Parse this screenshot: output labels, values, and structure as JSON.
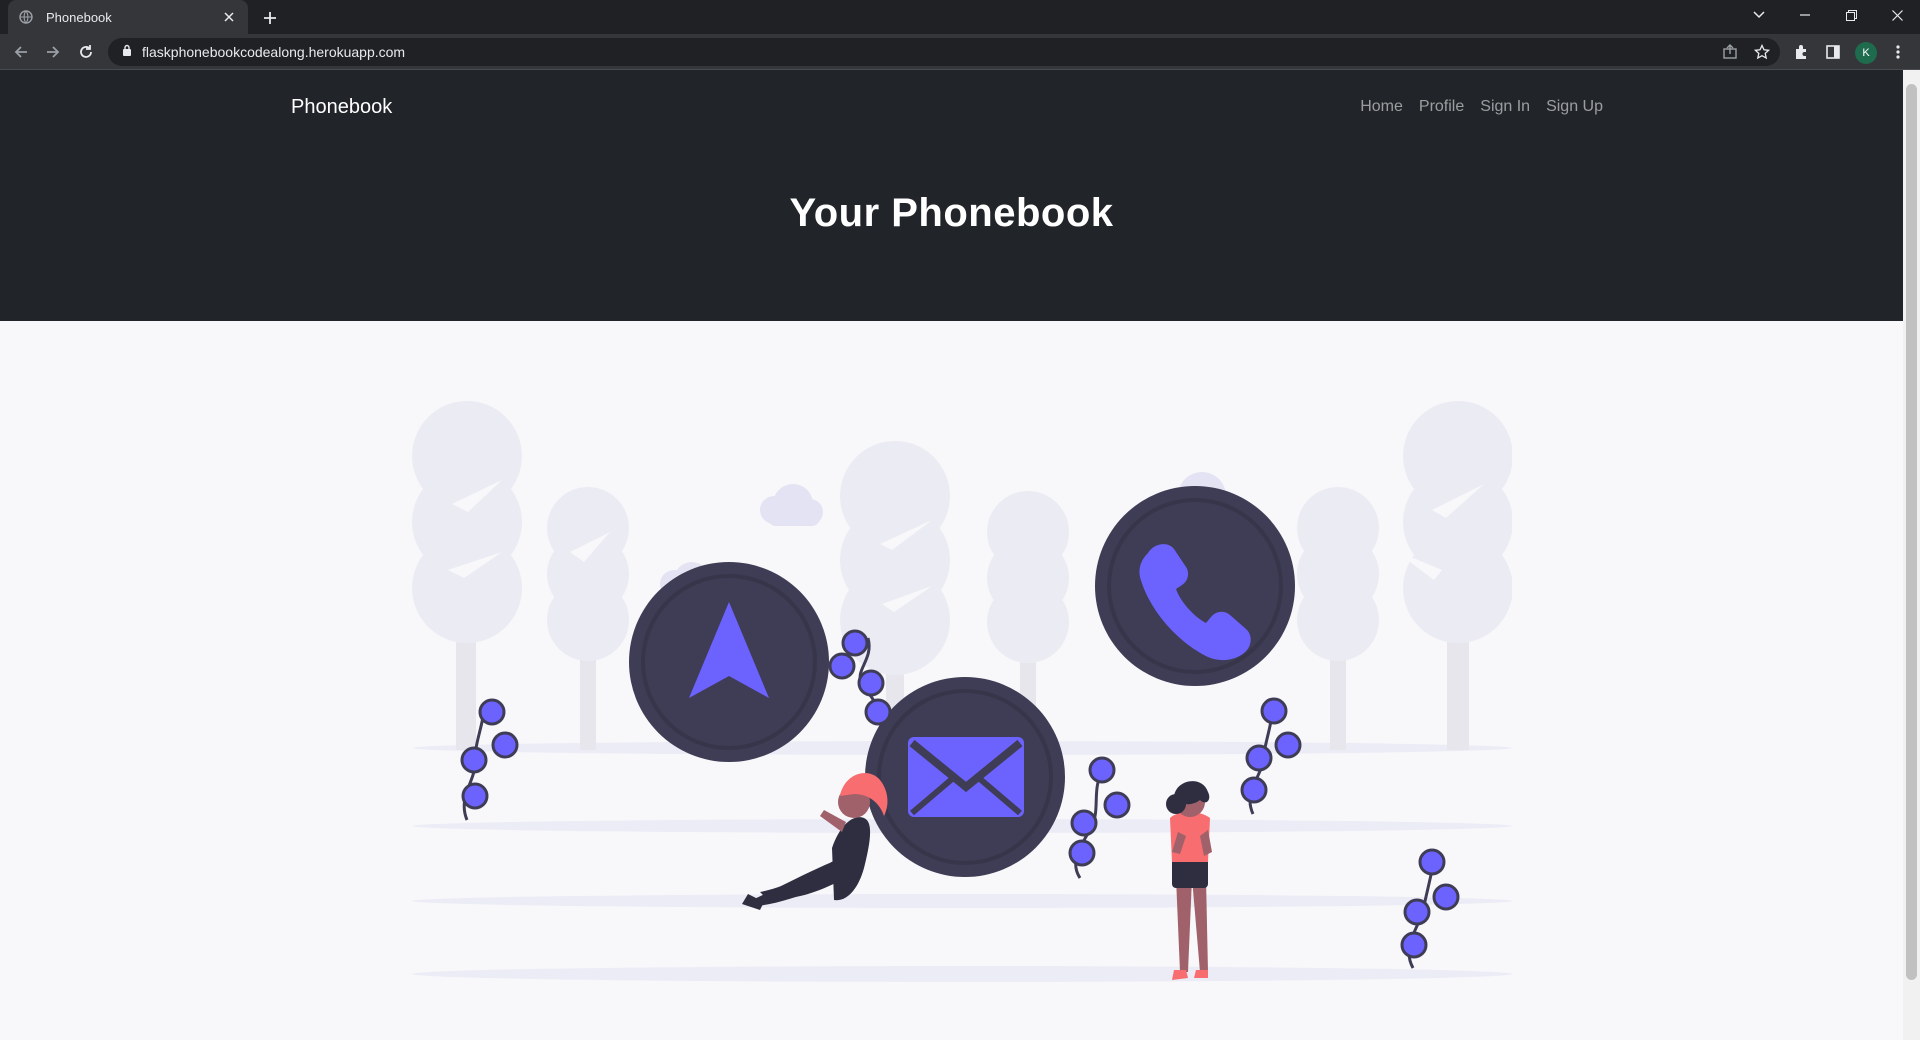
{
  "browser": {
    "tab_title": "Phonebook",
    "url": "flaskphonebookcodealong.herokuapp.com",
    "profile_initial": "K"
  },
  "navbar": {
    "brand": "Phonebook",
    "links": [
      "Home",
      "Profile",
      "Sign In",
      "Sign Up"
    ]
  },
  "hero": {
    "title": "Your Phonebook"
  },
  "colors": {
    "dark": "#212529",
    "accent": "#6c63ff",
    "circle": "#3f3d56",
    "tree": "#ececf6"
  },
  "illustration": {
    "icons": [
      "navigation-arrow-icon",
      "envelope-icon",
      "phone-icon"
    ]
  }
}
